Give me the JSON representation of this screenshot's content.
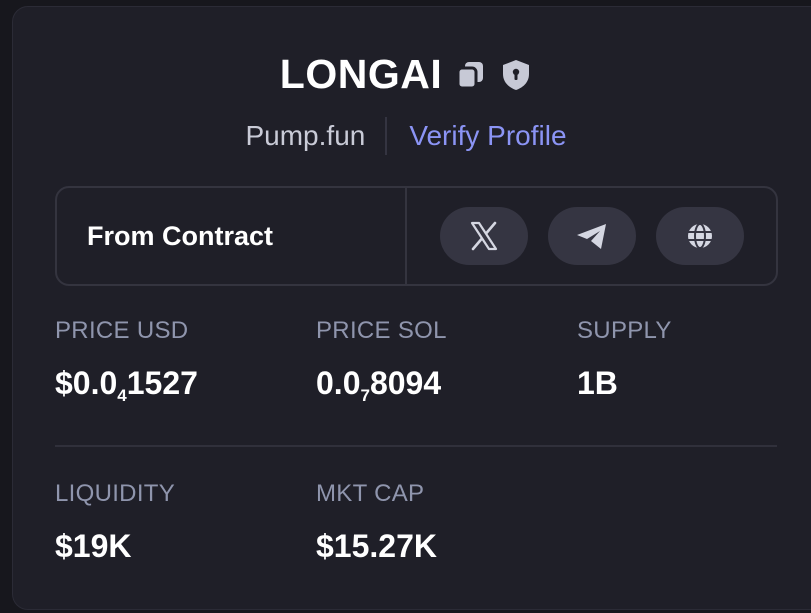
{
  "header": {
    "title": "LONGAI",
    "platform": "Pump.fun",
    "verify_label": "Verify Profile"
  },
  "contract": {
    "label": "From Contract"
  },
  "socials": [
    {
      "name": "x-icon"
    },
    {
      "name": "telegram-icon"
    },
    {
      "name": "globe-icon"
    }
  ],
  "stats": {
    "price_usd": {
      "label": "PRICE USD",
      "prefix": "$0.0",
      "sub": "4",
      "suffix": "1527"
    },
    "price_sol": {
      "label": "PRICE SOL",
      "prefix": "0.0",
      "sub": "7",
      "suffix": "8094"
    },
    "supply": {
      "label": "SUPPLY",
      "value": "1B"
    },
    "liquidity": {
      "label": "LIQUIDITY",
      "value": "$19K"
    },
    "mkt_cap": {
      "label": "MKT CAP",
      "value": "$15.27K"
    }
  },
  "colors": {
    "accent": "#8b94f5",
    "card_bg": "#1f1f28",
    "label": "#8f95ad"
  }
}
